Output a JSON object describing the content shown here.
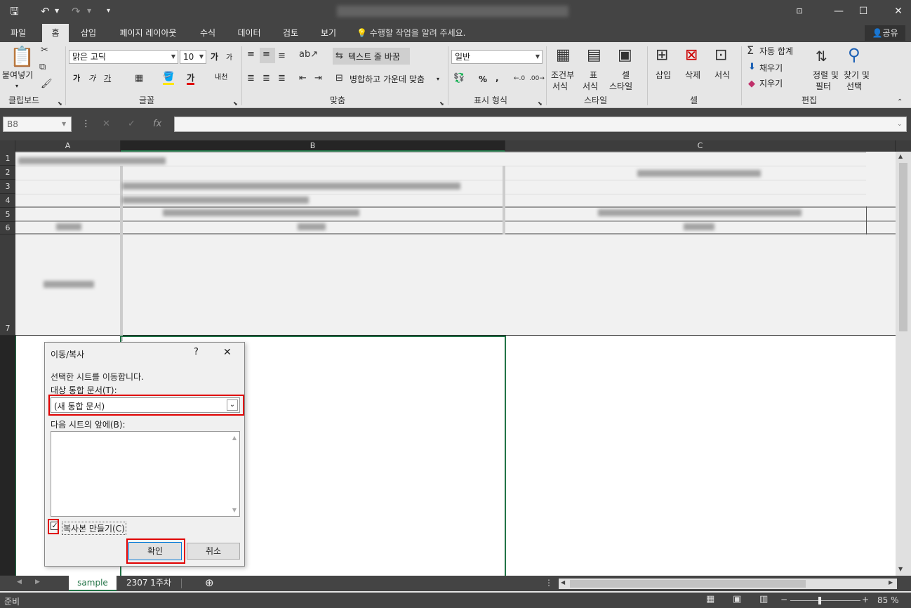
{
  "qat": {
    "save_icon": "save-icon",
    "undo_icon": "undo-icon",
    "redo_icon": "redo-icon",
    "customize_icon": "customize-icon"
  },
  "tabs": [
    {
      "label": "파일"
    },
    {
      "label": "홈"
    },
    {
      "label": "삽입"
    },
    {
      "label": "페이지 레이아웃"
    },
    {
      "label": "수식"
    },
    {
      "label": "데이터"
    },
    {
      "label": "검토"
    },
    {
      "label": "보기"
    }
  ],
  "tell_me": "수행할 작업을 알려 주세요.",
  "share": "공유",
  "ribbon": {
    "clipboard": {
      "paste": "붙여넣기",
      "label": "클립보드"
    },
    "font": {
      "name": "맑은 고딕",
      "size": "10",
      "bold": "가",
      "italic": "가",
      "underline": "가",
      "grow": "가",
      "shrink": "가",
      "font_color": "가",
      "phonetic": "내천",
      "label": "글꼴"
    },
    "alignment": {
      "wrap": "텍스트 줄 바꿈",
      "merge": "병합하고 가운데 맞춤",
      "label": "맞춤"
    },
    "number": {
      "format": "일반",
      "percent": "%",
      "comma": ",",
      "label": "표시 형식"
    },
    "styles": {
      "conditional": "조건부",
      "conditional2": "서식",
      "table": "표",
      "table2": "서식",
      "cell": "셀",
      "cell2": "스타일",
      "label": "스타일"
    },
    "cells": {
      "insert": "삽입",
      "delete": "삭제",
      "format": "서식",
      "label": "셀"
    },
    "editing": {
      "autosum": "자동 합계",
      "fill": "채우기",
      "clear": "지우기",
      "sort": "정렬 및",
      "sort2": "필터",
      "find": "찾기 및",
      "find2": "선택",
      "label": "편집"
    }
  },
  "name_box": "B8",
  "fx": "fx",
  "columns": [
    "A",
    "B",
    "C"
  ],
  "rows": [
    "1",
    "2",
    "3",
    "4",
    "5",
    "6",
    "7"
  ],
  "dialog": {
    "title": "이동/복사",
    "help": "?",
    "close": "✕",
    "message": "선택한 시트를 이동합니다.",
    "target_label": "대상 통합 문서(T):",
    "target_value": "(새 통합 문서)",
    "before_label": "다음 시트의 앞에(B):",
    "copy_label": "복사본 만들기(C)",
    "copy_checked": true,
    "ok": "확인",
    "cancel": "취소"
  },
  "sheets": [
    {
      "label": "sample",
      "active": true
    },
    {
      "label": "2307 1주차",
      "active": false
    }
  ],
  "status": {
    "ready": "준비",
    "zoom": "85 %",
    "zoom_level": 0.85
  },
  "colors": {
    "accent": "#217346",
    "highlight": "#e00000"
  }
}
